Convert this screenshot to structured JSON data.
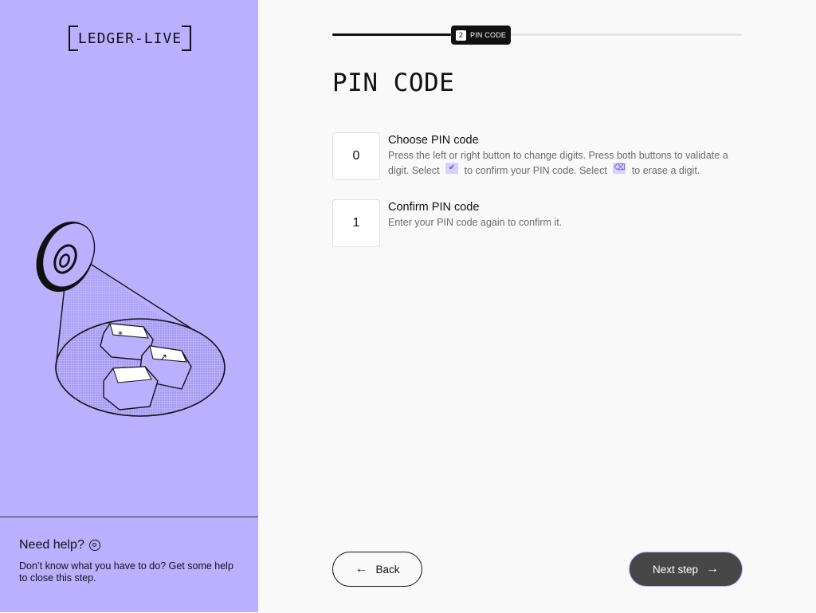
{
  "sidebar": {
    "logo": "LEDGER-LIVE",
    "help": {
      "title": "Need help?",
      "icon": "lifebuoy-icon",
      "text": "Don’t know what you have to do? Get some help to close this step."
    }
  },
  "progress": {
    "fraction": 0.29,
    "step_number": "2",
    "step_label": "PIN CODE"
  },
  "page": {
    "title": "PIN CODE"
  },
  "steps": [
    {
      "number": "0",
      "title": "Choose PIN code",
      "desc_part1": "Press the left or right button to change digits. Press both buttons to validate a digit. Select",
      "desc_part2": "to confirm your PIN code. Select",
      "desc_part3": "to erase a digit.",
      "icon_confirm": "check-icon",
      "icon_erase": "backspace-icon"
    },
    {
      "number": "1",
      "title": "Confirm PIN code",
      "desc": "Enter your PIN code again to confirm it."
    }
  ],
  "buttons": {
    "back": "Back",
    "next": "Next step"
  },
  "colors": {
    "sidebar_bg": "#bbb0ff",
    "main_bg": "#f9f9f9",
    "next_button": "#474747"
  }
}
